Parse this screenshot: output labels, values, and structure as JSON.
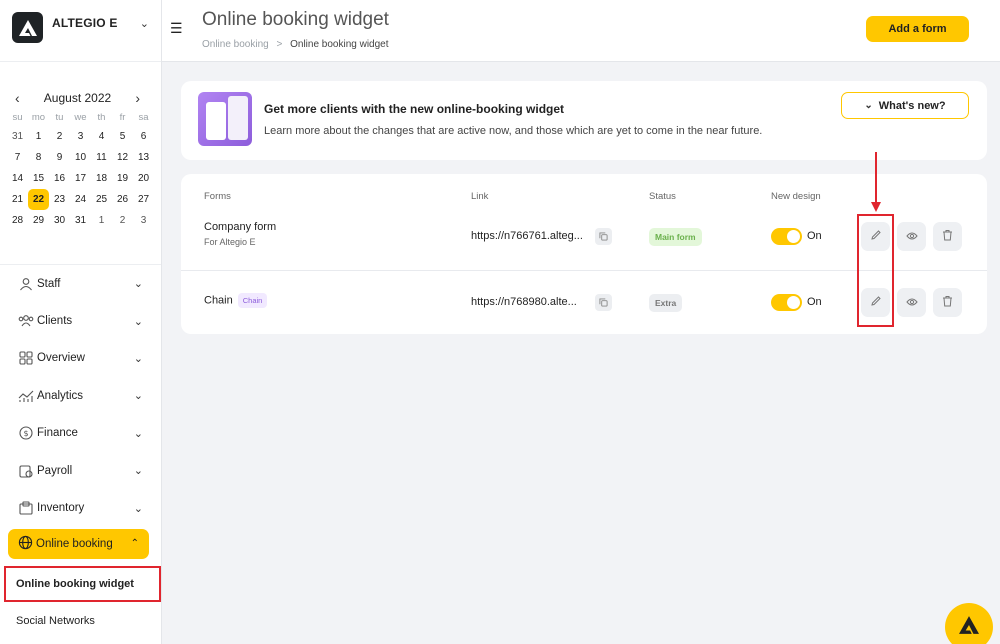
{
  "sidebar": {
    "company_name": "ALTEGIO E",
    "calendar": {
      "month": "August 2022",
      "weekdays": [
        "su",
        "mo",
        "tu",
        "we",
        "th",
        "fr",
        "sa"
      ],
      "weeks": [
        [
          "31",
          "1",
          "2",
          "3",
          "4",
          "5",
          "6"
        ],
        [
          "7",
          "8",
          "9",
          "10",
          "11",
          "12",
          "13"
        ],
        [
          "14",
          "15",
          "16",
          "17",
          "18",
          "19",
          "20"
        ],
        [
          "21",
          "22",
          "23",
          "24",
          "25",
          "26",
          "27"
        ],
        [
          "28",
          "29",
          "30",
          "31",
          "1",
          "2",
          "3"
        ]
      ],
      "selected_day": "22"
    },
    "nav": [
      {
        "label": "Staff",
        "icon": "person-icon"
      },
      {
        "label": "Clients",
        "icon": "people-icon"
      },
      {
        "label": "Overview",
        "icon": "grid-icon"
      },
      {
        "label": "Analytics",
        "icon": "analytics-icon"
      },
      {
        "label": "Finance",
        "icon": "dollar-icon"
      },
      {
        "label": "Payroll",
        "icon": "payroll-icon"
      },
      {
        "label": "Inventory",
        "icon": "box-icon"
      }
    ],
    "active_nav": {
      "label": "Online booking",
      "icon": "globe-icon"
    },
    "sub_items": [
      "Online booking widget",
      "Social Networks"
    ]
  },
  "header": {
    "title": "Online booking widget",
    "breadcrumb": [
      "Online booking",
      "Online booking widget"
    ],
    "breadcrumb_sep": ">",
    "add_button": "Add a form"
  },
  "promo": {
    "title": "Get more clients with the new online-booking widget",
    "text": "Learn more about the changes that are active now, and those which are yet to come in the near future.",
    "button": "What's new?"
  },
  "forms_table": {
    "headers": {
      "forms": "Forms",
      "link": "Link",
      "status": "Status",
      "new_design": "New design"
    },
    "rows": [
      {
        "name": "Company form",
        "sub": "For Altegio E",
        "chip": "",
        "link": "https://n766761.alteg...",
        "status": "Main form",
        "toggle_label": "On",
        "toggle_on": true
      },
      {
        "name": "Chain",
        "sub": "",
        "chip": "Chain",
        "link": "https://n768980.alte...",
        "status": "Extra",
        "toggle_label": "On",
        "toggle_on": true
      }
    ]
  },
  "colors": {
    "accent": "#ffc700",
    "highlight": "#e0252e",
    "chip_purple": "#8d5ddb",
    "status_green": "#6ab04c"
  }
}
